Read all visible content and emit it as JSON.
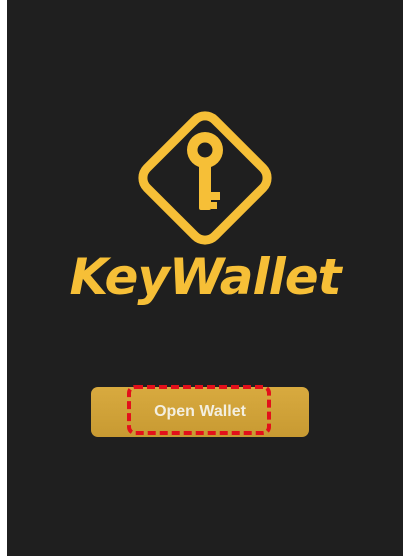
{
  "app": {
    "brand_name": "KeyWallet",
    "logo_icon": "key-diamond-icon"
  },
  "actions": {
    "open_wallet_label": "Open Wallet"
  },
  "colors": {
    "background": "#1f1f1f",
    "brand_gold": "#f6bf37",
    "button_gold": "#d2a43a",
    "highlight_red": "#e3101a"
  }
}
